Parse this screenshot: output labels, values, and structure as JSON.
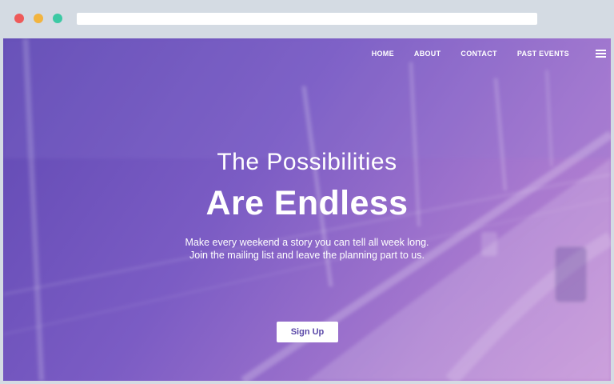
{
  "browser": {
    "window_buttons": [
      "close",
      "minimize",
      "maximize"
    ]
  },
  "nav": {
    "links": [
      "HOME",
      "ABOUT",
      "CONTACT",
      "PAST EVENTS"
    ],
    "menu_icon": "hamburger-icon"
  },
  "hero": {
    "line1": "The Possibilities",
    "line2": "Are Endless",
    "sub1": "Make every weekend a story you can tell all week long.",
    "sub2": "Join the mailing list and leave the planning part to us.",
    "cta": "Sign Up"
  },
  "colors": {
    "gradient_start": "#6049b3",
    "gradient_end": "#be86d2",
    "cta_text": "#5a48a8",
    "chrome_bg": "#d4dbe3"
  }
}
